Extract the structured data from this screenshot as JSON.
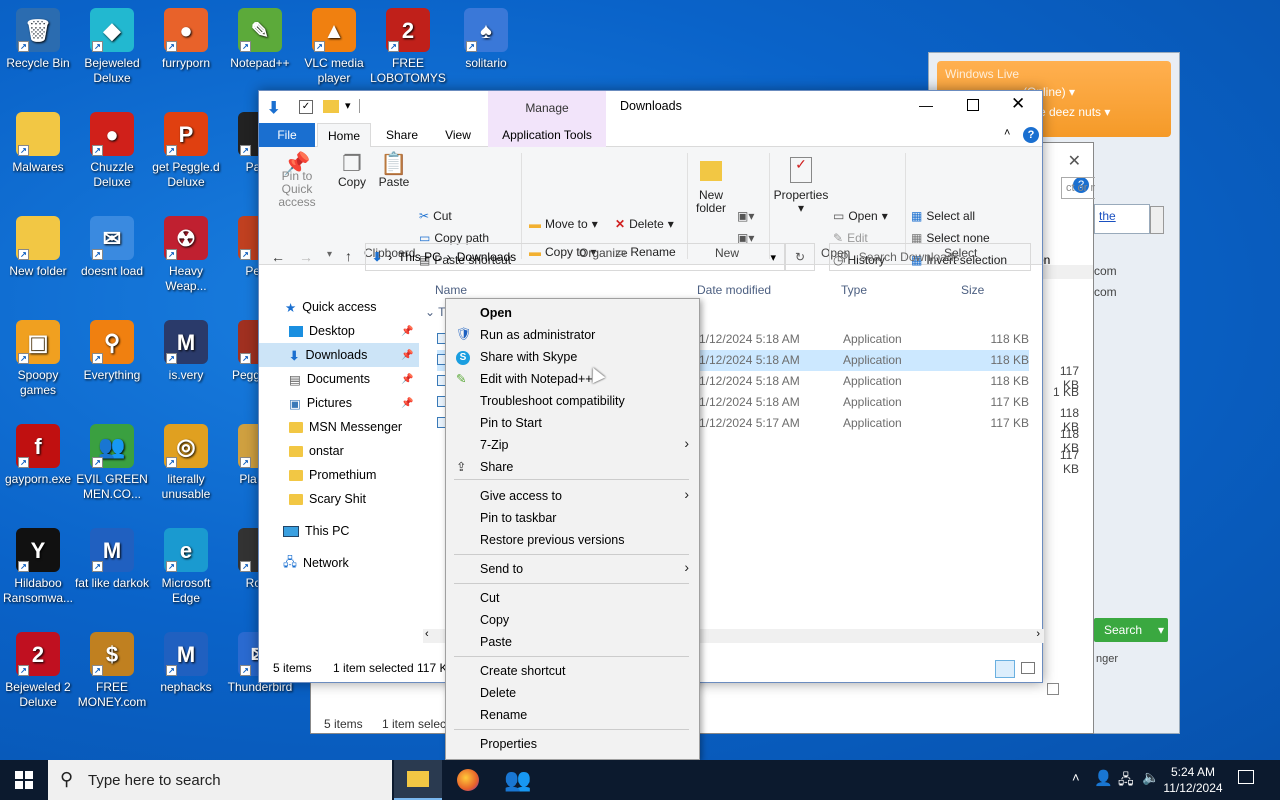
{
  "desktop_icons": [
    {
      "label": "Recycle Bin",
      "glyph": "🗑",
      "bg": "#2b6cb0"
    },
    {
      "label": "Bejeweled Deluxe",
      "glyph": "◆",
      "bg": "#22b8d0"
    },
    {
      "label": "furryporn",
      "glyph": "●",
      "bg": "#e8622a"
    },
    {
      "label": "Notepad++",
      "glyph": "✎",
      "bg": "#5caa3a"
    },
    {
      "label": "VLC media player",
      "glyph": "▲",
      "bg": "#f08010"
    },
    {
      "label": "FREE LOBOTOMYS",
      "glyph": "2",
      "bg": "#c0201a"
    },
    {
      "label": "solitario",
      "glyph": "♠",
      "bg": "#3a78d8"
    },
    {
      "label": "Malwares",
      "glyph": "",
      "bg": "#f2c744"
    },
    {
      "label": "Chuzzle Deluxe",
      "glyph": "●",
      "bg": "#d0201a"
    },
    {
      "label": "get Peggle.d Deluxe",
      "glyph": "P",
      "bg": "#e04010"
    },
    {
      "label": "Pa Pl",
      "glyph": "",
      "bg": "#222"
    },
    {
      "label": "New folder",
      "glyph": "",
      "bg": "#f2c744"
    },
    {
      "label": "doesnt load",
      "glyph": "✉",
      "bg": "#3a8ae0"
    },
    {
      "label": "Heavy Weap...",
      "glyph": "☢",
      "bg": "#c02030"
    },
    {
      "label": "Pe Ni",
      "glyph": "",
      "bg": "#c04020"
    },
    {
      "label": "Spoopy games",
      "glyph": "▣",
      "bg": "#f0a020"
    },
    {
      "label": "Everything",
      "glyph": "⚲",
      "bg": "#f08010"
    },
    {
      "label": "is.very",
      "glyph": "M",
      "bg": "#2a3a6a"
    },
    {
      "label": "Pegg of W",
      "glyph": "",
      "bg": "#a03020"
    },
    {
      "label": "gayporn.exe",
      "glyph": "f",
      "bg": "#c01010"
    },
    {
      "label": "EVIL GREEN MEN.CO...",
      "glyph": "👥",
      "bg": "#3aa040"
    },
    {
      "label": "literally unusable",
      "glyph": "◎",
      "bg": "#e0a020"
    },
    {
      "label": "Pla Zon",
      "glyph": "",
      "bg": "#cfa040"
    },
    {
      "label": "Hildaboo Ransomwa...",
      "glyph": "Y",
      "bg": "#111"
    },
    {
      "label": "fat like darkok",
      "glyph": "M",
      "bg": "#2060c0"
    },
    {
      "label": "Microsoft Edge",
      "glyph": "e",
      "bg": "#1a9ad0"
    },
    {
      "label": "Ro M",
      "glyph": "",
      "bg": "#333"
    },
    {
      "label": "Bejeweled 2 Deluxe",
      "glyph": "2",
      "bg": "#c01020"
    },
    {
      "label": "FREE MONEY.com",
      "glyph": "$",
      "bg": "#c08020"
    },
    {
      "label": "nephacks",
      "glyph": "M",
      "bg": "#2060c0"
    },
    {
      "label": "Thunderbird",
      "glyph": "✉",
      "bg": "#2a6ad0"
    }
  ],
  "msn": {
    "title": "Windows Live",
    "status": "(Online)",
    "message": "rate deez nuts",
    "search_placeholder": "ct or numbe",
    "link": "the",
    "row1": "on",
    "row2": "com",
    "row3": "com",
    "search_btn": "Search",
    "footer": "nger",
    "sizes": [
      "117 KB",
      "1 KB",
      "118 KB",
      "118 KB",
      "117 KB"
    ]
  },
  "back_window": {
    "items": "5 items",
    "selected": "1 item selec"
  },
  "explorer": {
    "title": "Downloads",
    "manage": "Manage",
    "tabs": {
      "file": "File",
      "home": "Home",
      "share": "Share",
      "view": "View",
      "app_tools": "Application Tools"
    },
    "ribbon": {
      "pin": "Pin to Quick access",
      "copy": "Copy",
      "paste": "Paste",
      "cut": "Cut",
      "copy_path": "Copy path",
      "paste_shortcut": "Paste shortcut",
      "clipboard": "Clipboard",
      "move_to": "Move to",
      "copy_to": "Copy to",
      "delete": "Delete",
      "rename": "Rename",
      "organize": "Organize",
      "new_folder": "New folder",
      "new": "New",
      "properties": "Properties",
      "open": "Open",
      "edit": "Edit",
      "history": "History",
      "open_group": "Open",
      "select_all": "Select all",
      "select_none": "Select none",
      "invert": "Invert selection",
      "select": "Select"
    },
    "address": {
      "this_pc": "This PC",
      "downloads": "Downloads",
      "search_placeholder": "Search Downloads"
    },
    "nav": {
      "quick_access": "Quick access",
      "desktop": "Desktop",
      "downloads": "Downloads",
      "documents": "Documents",
      "pictures": "Pictures",
      "msn": "MSN Messenger",
      "onstar": "onstar",
      "promethium": "Promethium",
      "scary": "Scary Shit",
      "this_pc": "This PC",
      "network": "Network"
    },
    "columns": {
      "name": "Name",
      "date": "Date modified",
      "type": "Type",
      "size": "Size"
    },
    "group": "T",
    "files": [
      {
        "date": "1/12/2024 5:18 AM",
        "type": "Application",
        "size": "118 KB"
      },
      {
        "date": "1/12/2024 5:18 AM",
        "type": "Application",
        "size": "118 KB"
      },
      {
        "date": "1/12/2024 5:18 AM",
        "type": "Application",
        "size": "118 KB"
      },
      {
        "date": "1/12/2024 5:18 AM",
        "type": "Application",
        "size": "117 KB"
      },
      {
        "date": "1/12/2024 5:17 AM",
        "type": "Application",
        "size": "117 KB"
      }
    ],
    "status": {
      "items": "5 items",
      "selected": "1 item selected",
      "size": "117 K"
    }
  },
  "context_menu": {
    "open": "Open",
    "run_admin": "Run as administrator",
    "skype": "Share with Skype",
    "notepad": "Edit with Notepad++",
    "troubleshoot": "Troubleshoot compatibility",
    "pin_start": "Pin to Start",
    "zip": "7-Zip",
    "share": "Share",
    "give_access": "Give access to",
    "pin_taskbar": "Pin to taskbar",
    "restore": "Restore previous versions",
    "send_to": "Send to",
    "cut": "Cut",
    "copy": "Copy",
    "paste": "Paste",
    "create_shortcut": "Create shortcut",
    "delete": "Delete",
    "rename": "Rename",
    "properties": "Properties"
  },
  "taskbar": {
    "search": "Type here to search",
    "time": "5:24 AM",
    "date": "11/12/2024"
  }
}
